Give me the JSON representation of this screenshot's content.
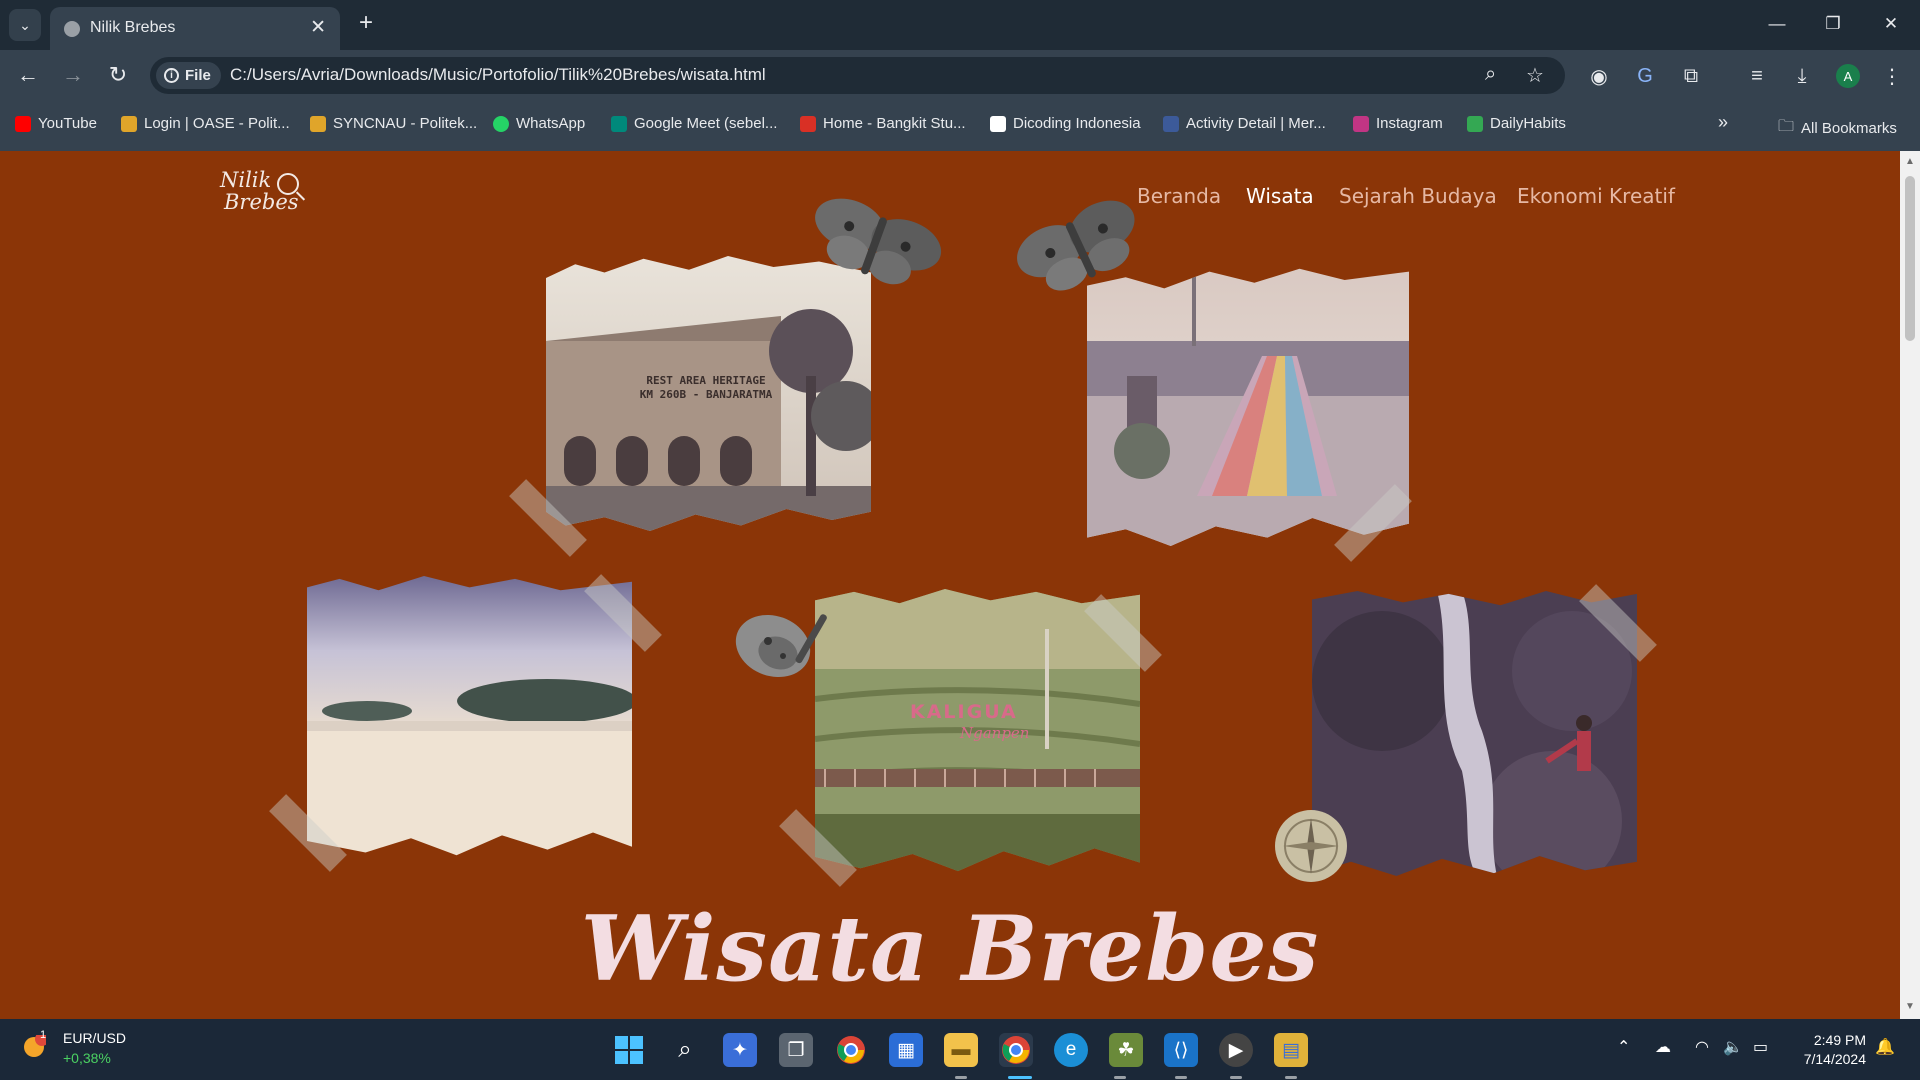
{
  "browser": {
    "tab_title": "Nilik Brebes",
    "url_scheme_label": "File",
    "url": "C:/Users/Avria/Downloads/Music/Portofolio/Tilik%20Brebes/wisata.html",
    "bookmarks": [
      {
        "label": "YouTube",
        "color": "#ff0000"
      },
      {
        "label": "Login | OASE - Polit...",
        "color": "#e0a52a"
      },
      {
        "label": "SYNCNAU - Politek...",
        "color": "#e0a52a"
      },
      {
        "label": "WhatsApp",
        "color": "#25d366"
      },
      {
        "label": "Google Meet (sebel...",
        "color": "#00897b"
      },
      {
        "label": "Home - Bangkit Stu...",
        "color": "#d93025"
      },
      {
        "label": "Dicoding Indonesia",
        "color": "#ffffff"
      },
      {
        "label": "Activity Detail | Mer...",
        "color": "#3c5a99"
      },
      {
        "label": "Instagram",
        "color": "#c13584"
      },
      {
        "label": "DailyHabits",
        "color": "#34a853"
      }
    ],
    "all_bookmarks_label": "All Bookmarks"
  },
  "site": {
    "logo_line1": "Nilik",
    "logo_line2": "Brebes",
    "nav": [
      "Beranda",
      "Wisata",
      "Sejarah Budaya",
      "Ekonomi Kreatif"
    ],
    "active_nav": "Wisata",
    "photo_captions": {
      "rest_area_line1": "REST AREA HERITAGE",
      "rest_area_line2": "KM 260B - BANJARATMA",
      "kaligua_line1": "KALIGUA",
      "kaligua_line2": "Nganpen"
    },
    "hero_title": "Wisata Brebes"
  },
  "taskbar": {
    "ticker_name": "EUR/USD",
    "ticker_change": "+0,38%",
    "ticker_badge": "1",
    "time": "2:49 PM",
    "date": "7/14/2024"
  }
}
